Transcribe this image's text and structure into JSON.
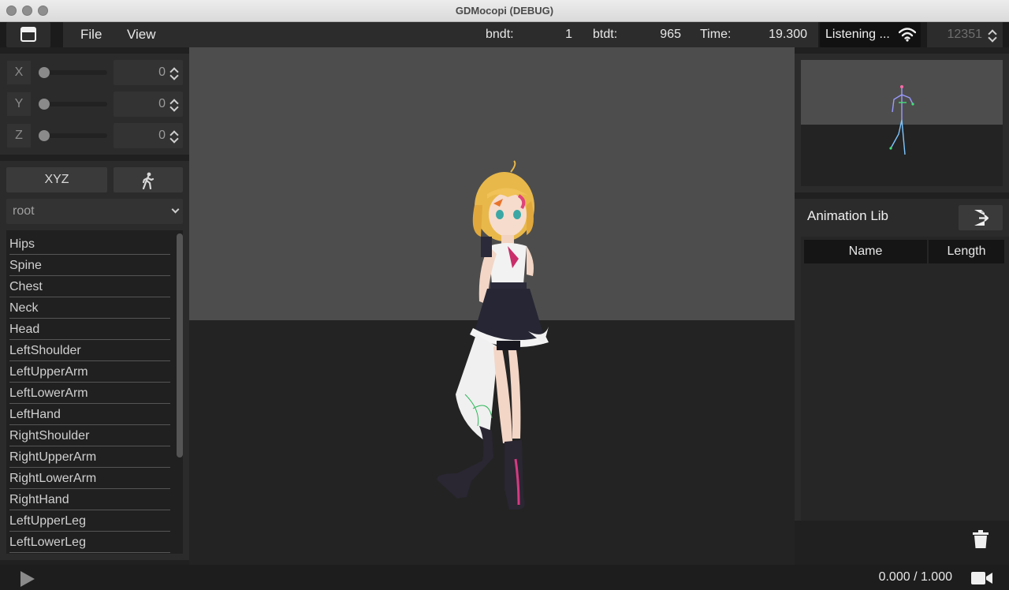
{
  "window": {
    "title": "GDMocopi (DEBUG)"
  },
  "menubar": {
    "file": "File",
    "view": "View",
    "bndt_label": "bndt:",
    "bndt_value": "1",
    "btdt_label": "btdt:",
    "btdt_value": "965",
    "time_label": "Time:",
    "time_value": "19.300",
    "listening": "Listening ...",
    "port": "12351"
  },
  "transform": {
    "x_label": "X",
    "x_value": "0",
    "y_label": "Y",
    "y_value": "0",
    "z_label": "Z",
    "z_value": "0"
  },
  "bones": {
    "tab_xyz": "XYZ",
    "selected_bone": "root",
    "items": [
      "Hips",
      "Spine",
      "Chest",
      "Neck",
      "Head",
      "LeftShoulder",
      "LeftUpperArm",
      "LeftLowerArm",
      "LeftHand",
      "RightShoulder",
      "RightUpperArm",
      "RightLowerArm",
      "RightHand",
      "LeftUpperLeg",
      "LeftLowerLeg"
    ]
  },
  "animation_lib": {
    "title": "Animation Lib",
    "col_name": "Name",
    "col_length": "Length"
  },
  "playback": {
    "time": "0.000 / 1.000"
  },
  "icons": {
    "window": "window-icon",
    "wifi": "wifi-icon",
    "walk": "walk-icon",
    "export": "export-icon",
    "trash": "trash-icon",
    "play": "play-icon",
    "camera": "video-camera-icon"
  }
}
